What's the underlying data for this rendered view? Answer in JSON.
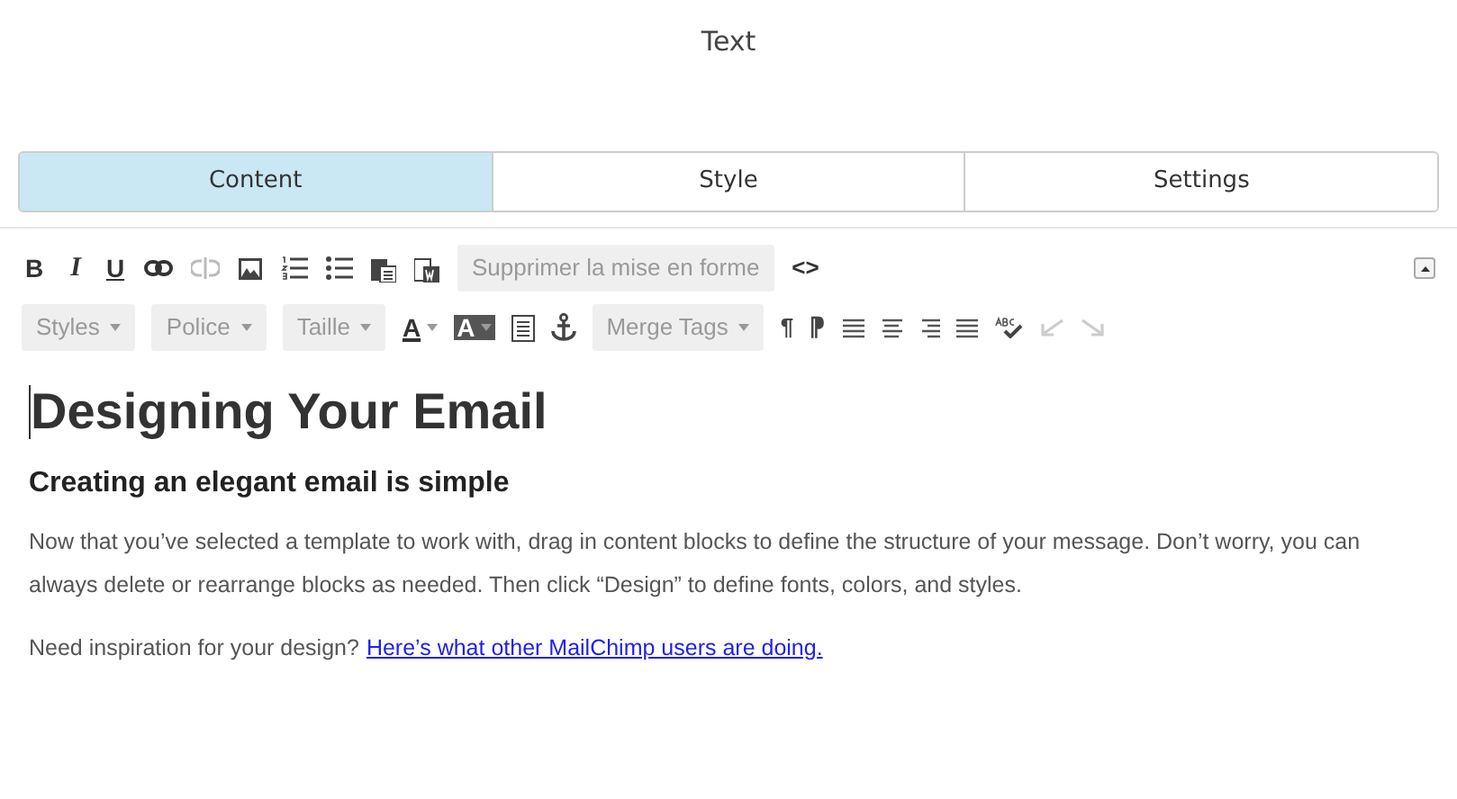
{
  "title": "Text",
  "tabs": [
    {
      "label": "Content",
      "selected": true
    },
    {
      "label": "Style",
      "selected": false
    },
    {
      "label": "Settings",
      "selected": false
    }
  ],
  "toolbar": {
    "bold": "B",
    "italic": "I",
    "underline": "U",
    "clear_format": "Supprimer la mise en forme",
    "source": "<>",
    "dropdowns": [
      "Styles",
      "Police",
      "Taille"
    ],
    "text_color": "A",
    "background_color": "A",
    "merge_tags": "Merge Tags",
    "ltr": "¶",
    "rtl": "⁋",
    "undo": {
      "disabled": true
    },
    "redo": {
      "disabled": true
    }
  },
  "content": {
    "heading": "Designing Your Email",
    "subheading": "Creating an elegant email is simple",
    "paragraphs": [
      "Now that you’ve selected a template to work with, drag in content blocks to define the structure of your message. Don’t worry, you can always delete or rearrange blocks as needed. Then click “Design” to define fonts, colors, and styles."
    ],
    "inspiration": {
      "text": "Need inspiration for your design?",
      "link": "Here’s what other MailChimp users are doing."
    }
  }
}
